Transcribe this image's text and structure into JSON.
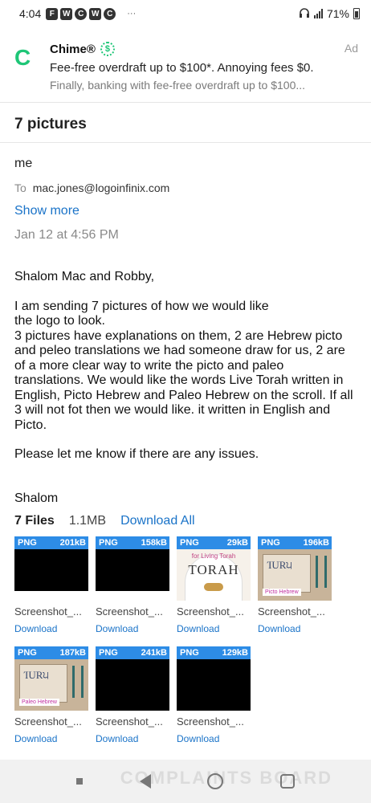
{
  "status_bar": {
    "time": "4:04",
    "app_icons": [
      "F",
      "W",
      "C",
      "W",
      "C"
    ],
    "more": "···",
    "battery": "71%"
  },
  "ad": {
    "logo": "C",
    "title": "Chime®",
    "badge": "$",
    "line1": "Fee-free overdraft up to $100*. Annoying fees $0.",
    "line2": "Finally, banking with fee-free overdraft up to $100...",
    "tag": "Ad"
  },
  "email": {
    "subject": "7 pictures",
    "sender": "me",
    "to_label": "To",
    "to_address": "mac.jones@logoinfinix.com",
    "show_more": "Show more",
    "date": "Jan 12 at 4:56 PM",
    "greeting": "Shalom Mac and Robby,",
    "paragraph": [
      "I am sending 7 pictures of how we would like",
      "the logo to look.",
      "3 pictures have explanations on them, 2 are Hebrew picto",
      "and peleo translations we had someone draw for us, 2 are",
      "of a more clear way to write the picto and paleo",
      "translations. We would like the words Live Torah written in",
      "English, Picto Hebrew and Paleo Hebrew on the scroll. If all",
      "3 will not fot then we would like. it written in English and",
      "Picto."
    ],
    "closing": "Please let me know if there are any issues.",
    "signoff": "Shalom"
  },
  "attachments": {
    "count_label": "7 Files",
    "total_size": "1.1MB",
    "download_all": "Download All",
    "files": [
      {
        "type": "PNG",
        "size": "201kB",
        "name": "Screenshot_...",
        "download": "Download",
        "preview": "dark"
      },
      {
        "type": "PNG",
        "size": "158kB",
        "name": "Screenshot_...",
        "download": "Download",
        "preview": "dark"
      },
      {
        "type": "PNG",
        "size": "29kB",
        "name": "Screenshot_...",
        "download": "Download",
        "preview": "torah",
        "preview_text": "TORAH",
        "preview_caption": "for Living Torah"
      },
      {
        "type": "PNG",
        "size": "196kB",
        "name": "Screenshot_...",
        "download": "Download",
        "preview": "sketch",
        "preview_caption": "Picto Hebrew"
      },
      {
        "type": "PNG",
        "size": "187kB",
        "name": "Screenshot_...",
        "download": "Download",
        "preview": "sketch",
        "preview_caption": "Paleo Hebrew"
      },
      {
        "type": "PNG",
        "size": "241kB",
        "name": "Screenshot_...",
        "download": "Download",
        "preview": "dark"
      },
      {
        "type": "PNG",
        "size": "129kB",
        "name": "Screenshot_...",
        "download": "Download",
        "preview": "dark"
      }
    ]
  },
  "watermark": "COMPLAINTS BOARD",
  "colors": {
    "link": "#1a73c8",
    "thumb_bar": "#2d8ce6",
    "chime_green": "#1ec677"
  }
}
